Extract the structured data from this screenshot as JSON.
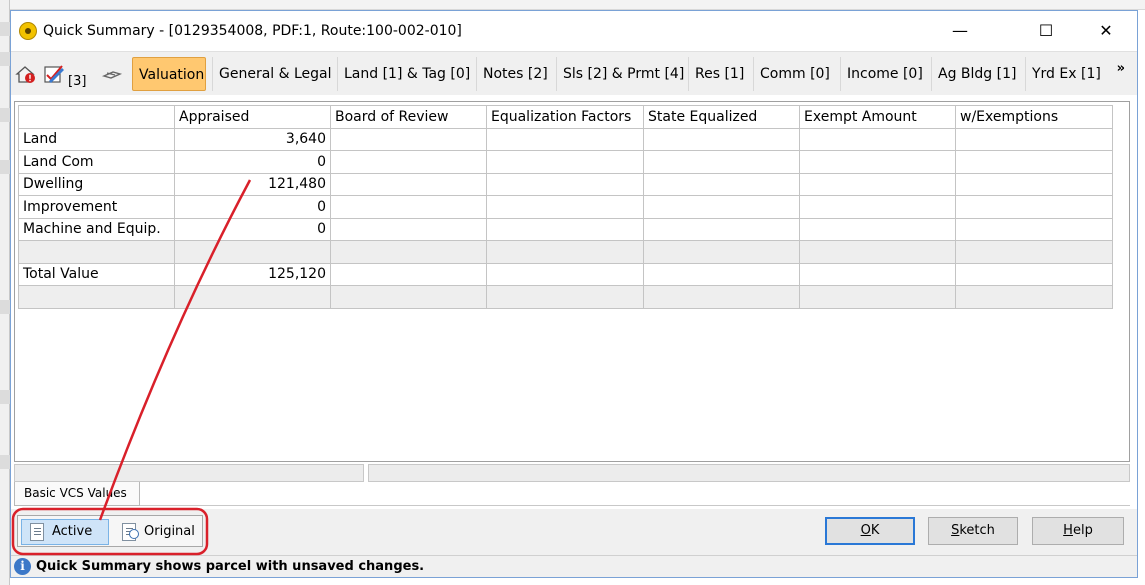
{
  "window": {
    "title": "Quick Summary - [0129354008, PDF:1, Route:100-002-010]",
    "minimize_glyph": "—",
    "maximize_glyph": "☐",
    "close_glyph": "✕"
  },
  "toolbar": {
    "count_label": "[3]",
    "more_glyph": "»",
    "icons": [
      "house-alert-icon",
      "edit-check-icon",
      "link-icon"
    ],
    "tabs": [
      {
        "label": "Valuation",
        "active": true
      },
      {
        "label": "General & Legal"
      },
      {
        "label": "Land [1] & Tag [0]"
      },
      {
        "label": "Notes [2]"
      },
      {
        "label": "Sls [2] & Prmt [4]"
      },
      {
        "label": "Res [1]"
      },
      {
        "label": "Comm [0]"
      },
      {
        "label": "Income [0]"
      },
      {
        "label": "Ag Bldg [1]"
      },
      {
        "label": "Yrd Ex [1]"
      }
    ]
  },
  "grid": {
    "columns": [
      "",
      "Appraised",
      "Board of Review",
      "Equalization Factors",
      "State Equalized",
      "Exempt Amount",
      "w/Exemptions"
    ],
    "rows": [
      {
        "label": "Land",
        "appraised": "3,640"
      },
      {
        "label": "Land Com",
        "appraised": "0"
      },
      {
        "label": "Dwelling",
        "appraised": "121,480"
      },
      {
        "label": "Improvement",
        "appraised": "0"
      },
      {
        "label": "Machine and Equip.",
        "appraised": "0"
      },
      {
        "label": "",
        "appraised": ""
      },
      {
        "label": "Total Value",
        "appraised": "125,120"
      },
      {
        "label": "",
        "appraised": ""
      }
    ]
  },
  "bottom_tab": {
    "label": "Basic VCS Values"
  },
  "mode": {
    "active_label": "Active",
    "original_label": "Original"
  },
  "buttons": {
    "ok": "OK",
    "sketch": "Sketch",
    "help": "Help"
  },
  "status": {
    "message": "Quick Summary shows parcel with unsaved changes."
  },
  "colors": {
    "annotation": "#d9202a",
    "active_tab": "#ffc870",
    "default_button_border": "#2a78d6"
  }
}
